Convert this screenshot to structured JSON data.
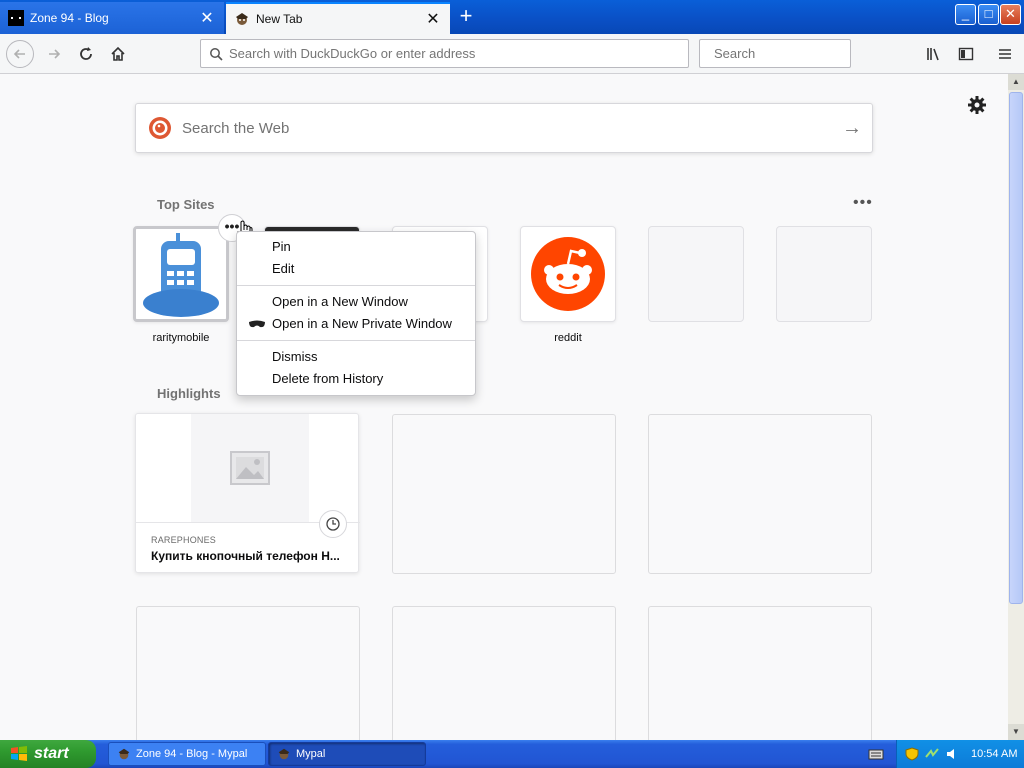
{
  "tabs": [
    {
      "title": "Zone 94 - Blog",
      "active": false
    },
    {
      "title": "New Tab",
      "active": true
    }
  ],
  "window": {
    "minimize": "_",
    "maximize": "□",
    "close": "✕"
  },
  "navbar": {
    "url_placeholder": "Search with DuckDuckGo or enter address",
    "search_placeholder": "Search"
  },
  "page": {
    "web_search_placeholder": "Search the Web",
    "top_sites_title": "Top Sites",
    "highlights_title": "Highlights",
    "top_sites": [
      {
        "label": "raritymobile"
      },
      {
        "label": ""
      },
      {
        "label": ""
      },
      {
        "label": "reddit"
      },
      {
        "label": ""
      },
      {
        "label": ""
      }
    ],
    "highlights": [
      {
        "source": "RAREPHONES",
        "title": "Купить кнопочный телефон Н..."
      }
    ]
  },
  "context_menu": {
    "items": [
      "Pin",
      "Edit",
      "Open in a New Window",
      "Open in a New Private Window",
      "Dismiss",
      "Delete from History"
    ]
  },
  "taskbar": {
    "start": "start",
    "tasks": [
      {
        "title": "Zone 94 - Blog - Mypal"
      },
      {
        "title": "Mypal"
      }
    ],
    "clock": "10:54 AM"
  },
  "colors": {
    "accent": "#0a84ff",
    "reddit": "#ff4500",
    "rarity_blue": "#4a90d9",
    "taskbar": "#245edb",
    "start_green": "#2f9a2f"
  }
}
